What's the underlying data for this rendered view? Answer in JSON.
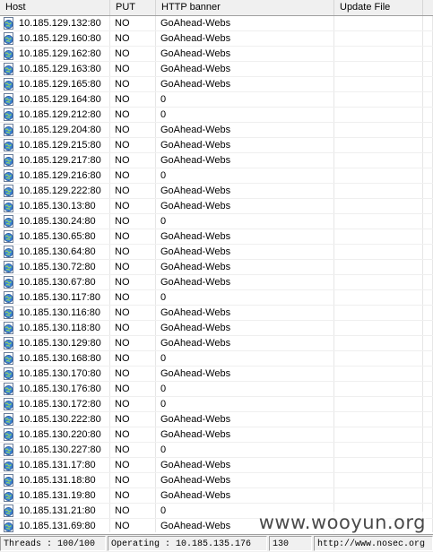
{
  "columns": {
    "host": "Host",
    "put": "PUT",
    "banner": "HTTP banner",
    "update": "Update File"
  },
  "rows": [
    {
      "host": "10.185.129.132:80",
      "put": "NO",
      "banner": "GoAhead-Webs",
      "update": ""
    },
    {
      "host": "10.185.129.160:80",
      "put": "NO",
      "banner": "GoAhead-Webs",
      "update": ""
    },
    {
      "host": "10.185.129.162:80",
      "put": "NO",
      "banner": "GoAhead-Webs",
      "update": ""
    },
    {
      "host": "10.185.129.163:80",
      "put": "NO",
      "banner": "GoAhead-Webs",
      "update": ""
    },
    {
      "host": "10.185.129.165:80",
      "put": "NO",
      "banner": "GoAhead-Webs",
      "update": ""
    },
    {
      "host": "10.185.129.164:80",
      "put": "NO",
      "banner": "0",
      "update": ""
    },
    {
      "host": "10.185.129.212:80",
      "put": "NO",
      "banner": "0",
      "update": ""
    },
    {
      "host": "10.185.129.204:80",
      "put": "NO",
      "banner": "GoAhead-Webs",
      "update": ""
    },
    {
      "host": "10.185.129.215:80",
      "put": "NO",
      "banner": "GoAhead-Webs",
      "update": ""
    },
    {
      "host": "10.185.129.217:80",
      "put": "NO",
      "banner": "GoAhead-Webs",
      "update": ""
    },
    {
      "host": "10.185.129.216:80",
      "put": "NO",
      "banner": "0",
      "update": ""
    },
    {
      "host": "10.185.129.222:80",
      "put": "NO",
      "banner": "GoAhead-Webs",
      "update": ""
    },
    {
      "host": "10.185.130.13:80",
      "put": "NO",
      "banner": "GoAhead-Webs",
      "update": ""
    },
    {
      "host": "10.185.130.24:80",
      "put": "NO",
      "banner": "0",
      "update": ""
    },
    {
      "host": "10.185.130.65:80",
      "put": "NO",
      "banner": "GoAhead-Webs",
      "update": ""
    },
    {
      "host": "10.185.130.64:80",
      "put": "NO",
      "banner": "GoAhead-Webs",
      "update": ""
    },
    {
      "host": "10.185.130.72:80",
      "put": "NO",
      "banner": "GoAhead-Webs",
      "update": ""
    },
    {
      "host": "10.185.130.67:80",
      "put": "NO",
      "banner": "GoAhead-Webs",
      "update": ""
    },
    {
      "host": "10.185.130.117:80",
      "put": "NO",
      "banner": "0",
      "update": ""
    },
    {
      "host": "10.185.130.116:80",
      "put": "NO",
      "banner": "GoAhead-Webs",
      "update": ""
    },
    {
      "host": "10.185.130.118:80",
      "put": "NO",
      "banner": "GoAhead-Webs",
      "update": ""
    },
    {
      "host": "10.185.130.129:80",
      "put": "NO",
      "banner": "GoAhead-Webs",
      "update": ""
    },
    {
      "host": "10.185.130.168:80",
      "put": "NO",
      "banner": "0",
      "update": ""
    },
    {
      "host": "10.185.130.170:80",
      "put": "NO",
      "banner": "GoAhead-Webs",
      "update": ""
    },
    {
      "host": "10.185.130.176:80",
      "put": "NO",
      "banner": "0",
      "update": ""
    },
    {
      "host": "10.185.130.172:80",
      "put": "NO",
      "banner": "0",
      "update": ""
    },
    {
      "host": "10.185.130.222:80",
      "put": "NO",
      "banner": "GoAhead-Webs",
      "update": ""
    },
    {
      "host": "10.185.130.220:80",
      "put": "NO",
      "banner": "GoAhead-Webs",
      "update": ""
    },
    {
      "host": "10.185.130.227:80",
      "put": "NO",
      "banner": "0",
      "update": ""
    },
    {
      "host": "10.185.131.17:80",
      "put": "NO",
      "banner": "GoAhead-Webs",
      "update": ""
    },
    {
      "host": "10.185.131.18:80",
      "put": "NO",
      "banner": "GoAhead-Webs",
      "update": ""
    },
    {
      "host": "10.185.131.19:80",
      "put": "NO",
      "banner": "GoAhead-Webs",
      "update": ""
    },
    {
      "host": "10.185.131.21:80",
      "put": "NO",
      "banner": "0",
      "update": ""
    },
    {
      "host": "10.185.131.69:80",
      "put": "NO",
      "banner": "GoAhead-Webs",
      "update": ""
    }
  ],
  "row_icon": "globe-page-icon",
  "status": {
    "threads": "Threads : 100/100",
    "operating": "Operating : 10.185.135.176",
    "count": "130",
    "url": "http://www.nosec.org"
  },
  "watermark": "www.wooyun.org",
  "colors": {
    "header_bg": "#f0f0f0",
    "icon_blue": "#2a6fc9"
  }
}
